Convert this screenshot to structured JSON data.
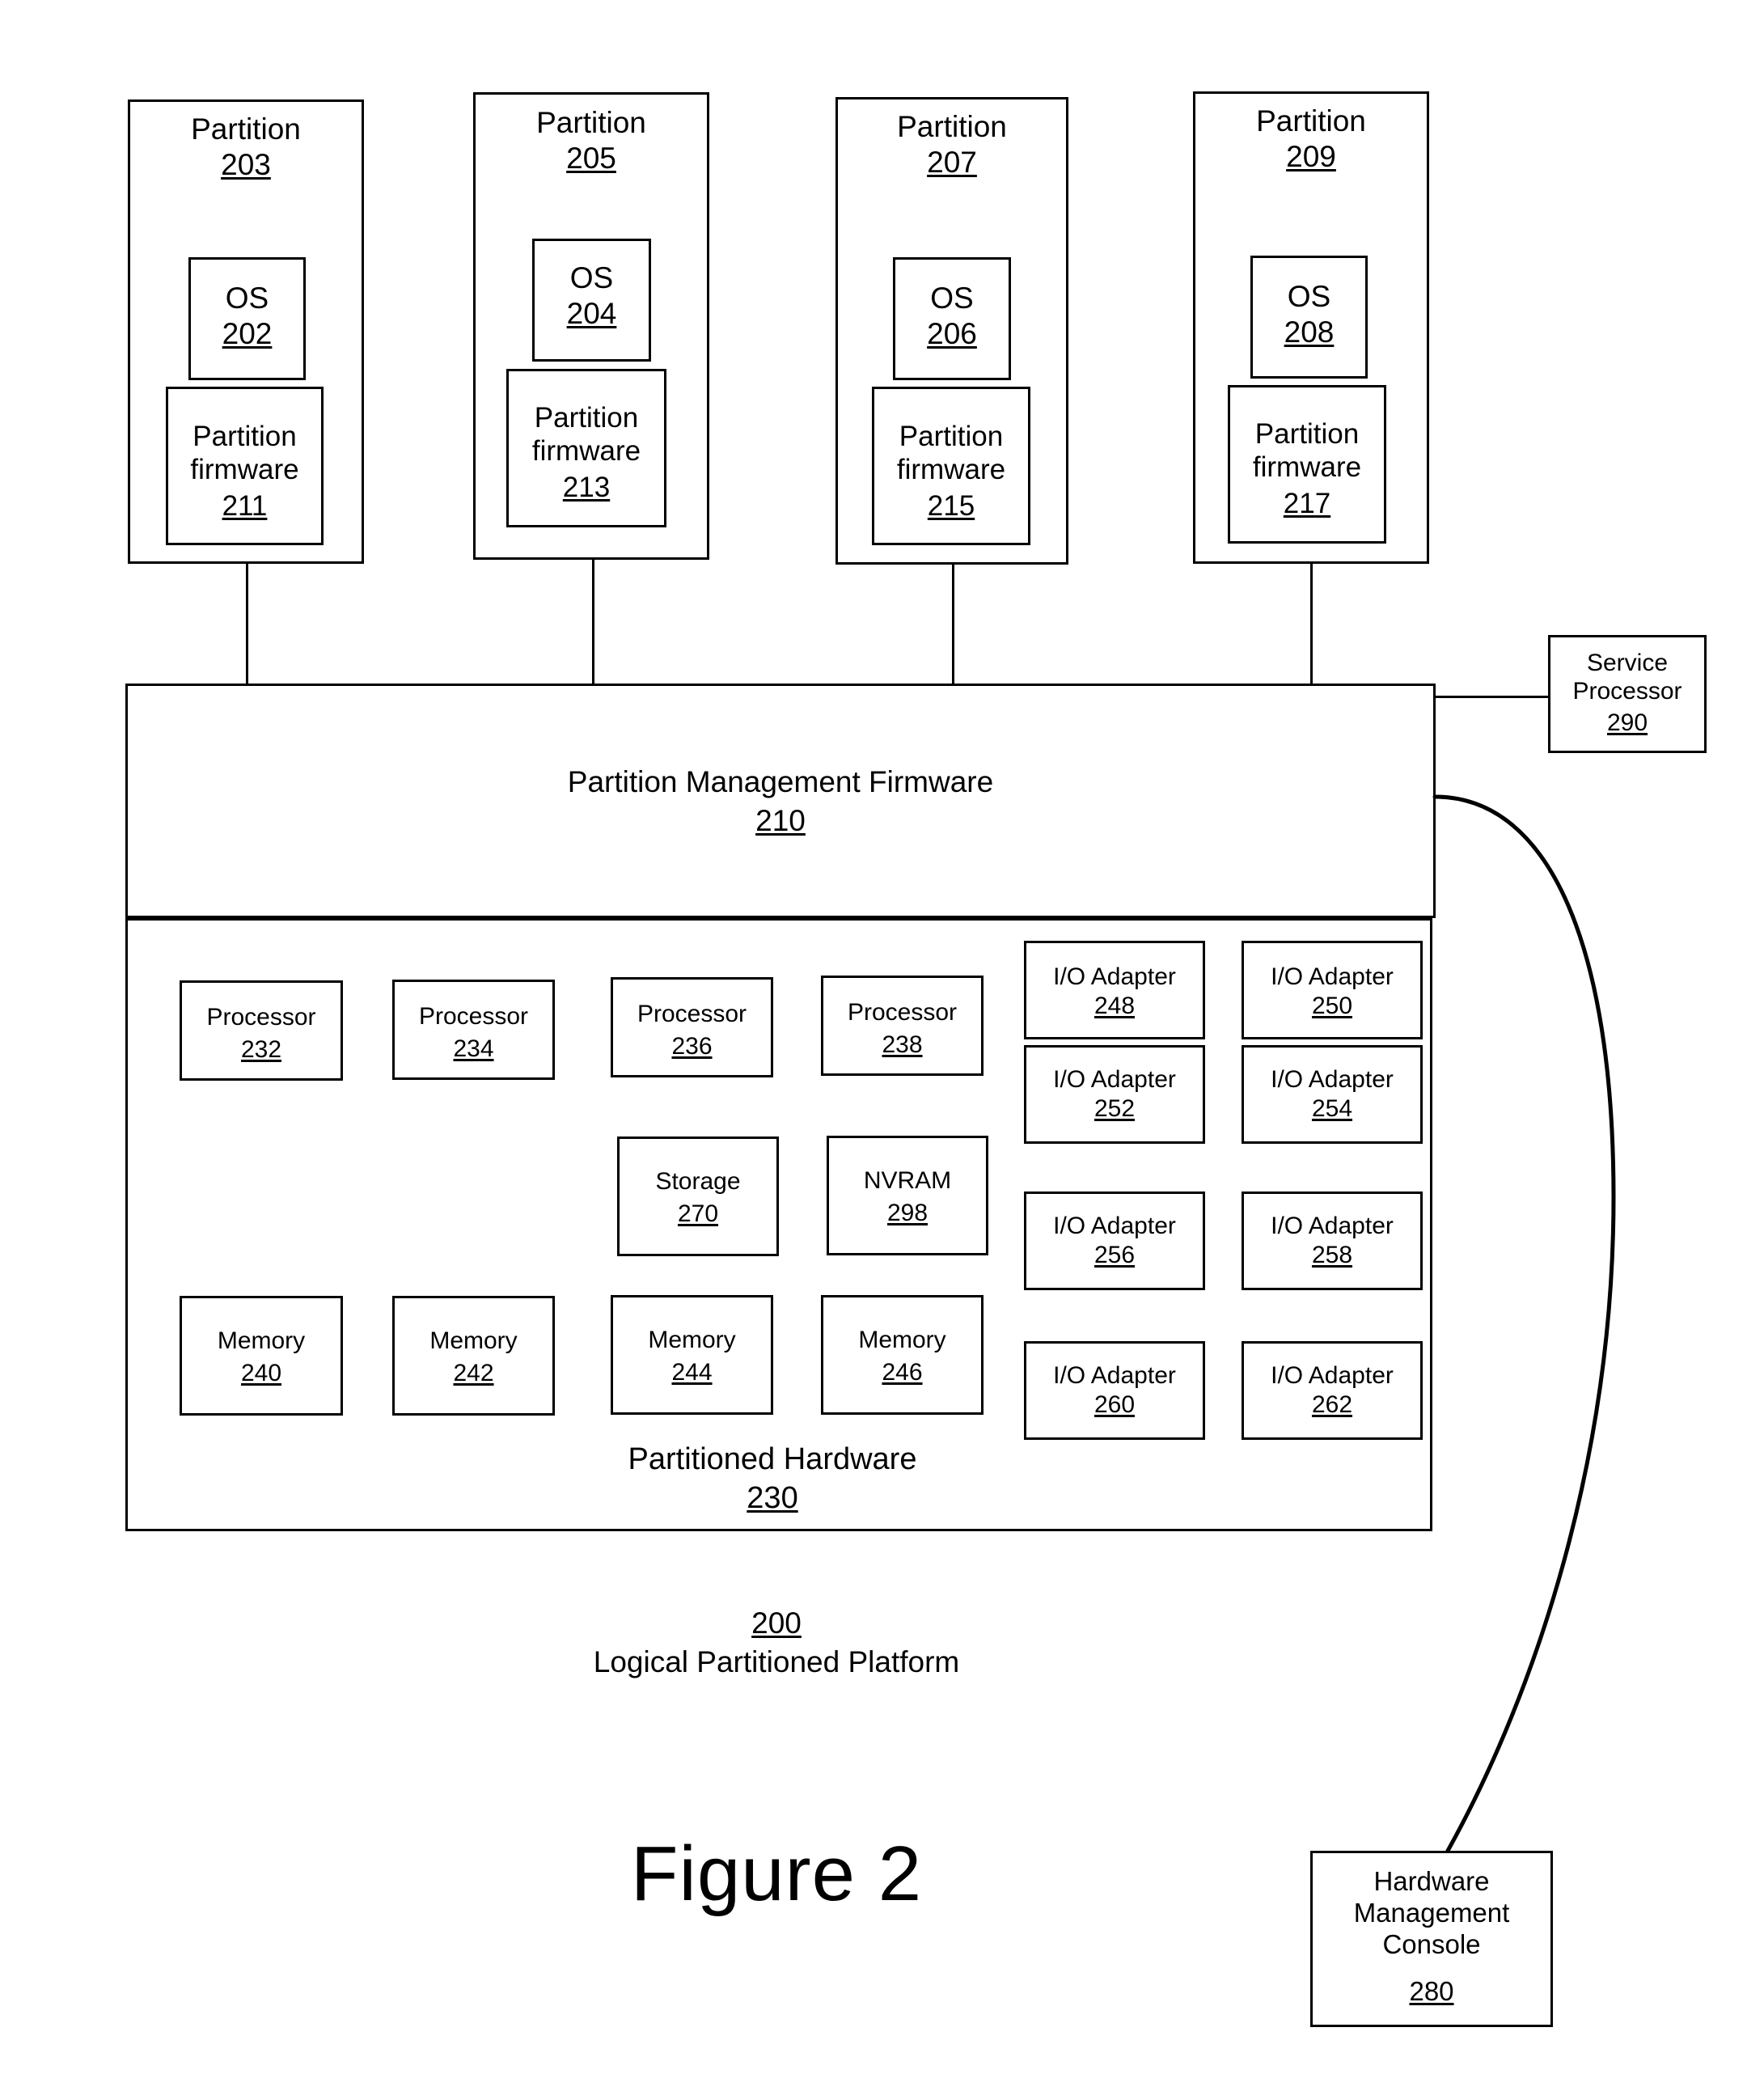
{
  "figure": {
    "caption": "Figure 2",
    "platform_ref": "200",
    "platform_label": "Logical Partitioned Platform"
  },
  "partitions": [
    {
      "title": "Partition",
      "ref": "203",
      "os": {
        "title": "OS",
        "ref": "202"
      },
      "firmware": {
        "title": "Partition\nfirmware",
        "ref": "211"
      }
    },
    {
      "title": "Partition",
      "ref": "205",
      "os": {
        "title": "OS",
        "ref": "204"
      },
      "firmware": {
        "title": "Partition\nfirmware",
        "ref": "213"
      }
    },
    {
      "title": "Partition",
      "ref": "207",
      "os": {
        "title": "OS",
        "ref": "206"
      },
      "firmware": {
        "title": "Partition\nfirmware",
        "ref": "215"
      }
    },
    {
      "title": "Partition",
      "ref": "209",
      "os": {
        "title": "OS",
        "ref": "208"
      },
      "firmware": {
        "title": "Partition\nfirmware",
        "ref": "217"
      }
    }
  ],
  "partition_management_firmware": {
    "title": "Partition Management Firmware",
    "ref": "210"
  },
  "service_processor": {
    "title": "Service\nProcessor",
    "ref": "290"
  },
  "hardware_management_console": {
    "title": "Hardware\nManagement\nConsole",
    "ref": "280"
  },
  "partitioned_hardware": {
    "title": "Partitioned Hardware",
    "ref": "230",
    "processors": [
      {
        "title": "Processor",
        "ref": "232"
      },
      {
        "title": "Processor",
        "ref": "234"
      },
      {
        "title": "Processor",
        "ref": "236"
      },
      {
        "title": "Processor",
        "ref": "238"
      }
    ],
    "storage": {
      "title": "Storage",
      "ref": "270"
    },
    "nvram": {
      "title": "NVRAM",
      "ref": "298"
    },
    "memories": [
      {
        "title": "Memory",
        "ref": "240"
      },
      {
        "title": "Memory",
        "ref": "242"
      },
      {
        "title": "Memory",
        "ref": "244"
      },
      {
        "title": "Memory",
        "ref": "246"
      }
    ],
    "io_adapters": [
      {
        "title": "I/O Adapter",
        "ref": "248"
      },
      {
        "title": "I/O Adapter",
        "ref": "250"
      },
      {
        "title": "I/O Adapter",
        "ref": "252"
      },
      {
        "title": "I/O Adapter",
        "ref": "254"
      },
      {
        "title": "I/O Adapter",
        "ref": "256"
      },
      {
        "title": "I/O Adapter",
        "ref": "258"
      },
      {
        "title": "I/O Adapter",
        "ref": "260"
      },
      {
        "title": "I/O Adapter",
        "ref": "262"
      }
    ]
  }
}
